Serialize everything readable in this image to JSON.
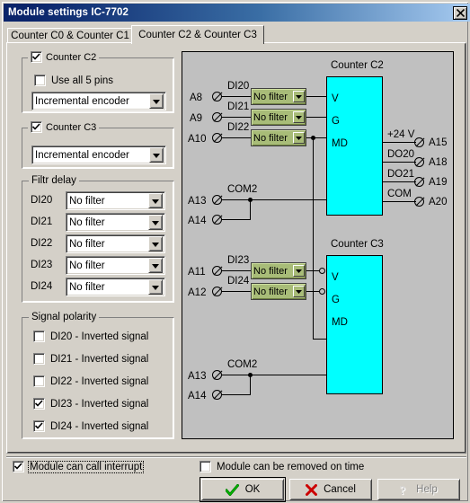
{
  "window": {
    "title": "Module settings IC-7702",
    "close_icon": "close-icon"
  },
  "tabs": [
    {
      "label": "Counter C0 & Counter C1",
      "active": false
    },
    {
      "label": "Counter C2 & Counter C3",
      "active": true
    }
  ],
  "counter_c2_group": {
    "enabled_label": "Counter C2",
    "enabled_checked": true,
    "use_all_pins_label": "Use all 5 pins",
    "use_all_pins_checked": false,
    "mode_value": "Incremental encoder"
  },
  "counter_c3_group": {
    "enabled_label": "Counter C3",
    "enabled_checked": true,
    "mode_value": "Incremental encoder"
  },
  "filtr_delay": {
    "caption": "Filtr delay",
    "rows": [
      {
        "label": "DI20",
        "value": "No filter"
      },
      {
        "label": "DI21",
        "value": "No filter"
      },
      {
        "label": "DI22",
        "value": "No filter"
      },
      {
        "label": "DI23",
        "value": "No filter"
      },
      {
        "label": "DI24",
        "value": "No filter"
      }
    ]
  },
  "signal_polarity": {
    "caption": "Signal polarity",
    "rows": [
      {
        "label": "DI20 - Inverted signal",
        "checked": false
      },
      {
        "label": "DI21 - Inverted signal",
        "checked": false
      },
      {
        "label": "DI22 - Inverted signal",
        "checked": false
      },
      {
        "label": "DI23 - Inverted signal",
        "checked": true
      },
      {
        "label": "DI24 - Inverted signal",
        "checked": true
      }
    ]
  },
  "diagram": {
    "counter_c2": {
      "title": "Counter C2",
      "pins": [
        "V",
        "G",
        "MD"
      ],
      "inputs": [
        {
          "terminal": "A8",
          "signal": "DI20",
          "filter": "No filter",
          "inverted": false
        },
        {
          "terminal": "A9",
          "signal": "DI21",
          "filter": "No filter",
          "inverted": false
        },
        {
          "terminal": "A10",
          "signal": "DI22",
          "filter": "No filter",
          "inverted": false
        }
      ],
      "outputs": [
        {
          "signal": "+24 V",
          "terminal": "A15"
        },
        {
          "signal": "DO20",
          "terminal": "A18"
        },
        {
          "signal": "DO21",
          "terminal": "A19"
        },
        {
          "signal": "COM",
          "terminal": "A20"
        }
      ],
      "common": {
        "signal": "COM2",
        "terminals": [
          "A13",
          "A14"
        ]
      }
    },
    "counter_c3": {
      "title": "Counter C3",
      "pins": [
        "V",
        "G",
        "MD"
      ],
      "inputs": [
        {
          "terminal": "A11",
          "signal": "DI23",
          "filter": "No filter",
          "inverted": true
        },
        {
          "terminal": "A12",
          "signal": "DI24",
          "filter": "No filter",
          "inverted": true
        }
      ],
      "common": {
        "signal": "COM2",
        "terminals": [
          "A13",
          "A14"
        ]
      }
    }
  },
  "footer": {
    "interrupt_label": "Module can call interrupt",
    "interrupt_checked": true,
    "removable_label": "Module can be removed on time",
    "removable_checked": false,
    "ok_label": "OK",
    "cancel_label": "Cancel",
    "help_label": "Help"
  },
  "colors": {
    "title_bar": "#0a246a",
    "face": "#d4d0c8",
    "diagram_bg": "#c0c0c0",
    "block": "#00ffff",
    "combo_green": "#a8bc78",
    "ok_check": "#008000",
    "cancel_x": "#cc0000"
  }
}
